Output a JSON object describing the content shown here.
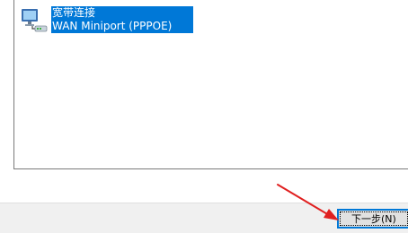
{
  "connection_list": {
    "items": [
      {
        "icon": "network-connection-icon",
        "name": "宽带连接",
        "device": "WAN Miniport (PPPOE)"
      }
    ]
  },
  "footer": {
    "next_label": "下一步(N)"
  },
  "annotation": {
    "arrow_color": "#e02020",
    "arrow_icon": "red-arrow-annotation"
  },
  "colors": {
    "selection": "#0078d7",
    "button_focus": "#0078d7"
  }
}
